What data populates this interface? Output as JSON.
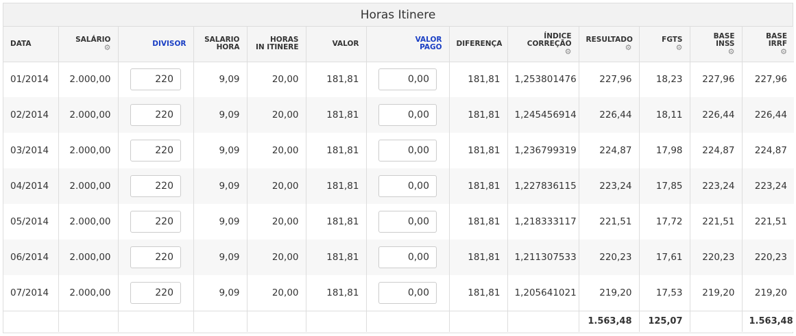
{
  "title": "Horas Itinere",
  "columns": [
    {
      "label1": "DATA",
      "label2": "",
      "gear": false
    },
    {
      "label1": "SALÁRIO",
      "label2": "",
      "gear": true
    },
    {
      "label1": "DIVISOR",
      "label2": "",
      "gear": false
    },
    {
      "label1": "SALARIO",
      "label2": "HORA",
      "gear": false
    },
    {
      "label1": "HORAS",
      "label2": "IN ITINERE",
      "gear": false
    },
    {
      "label1": "VALOR",
      "label2": "",
      "gear": false
    },
    {
      "label1": "VALOR",
      "label2": "PAGO",
      "gear": false
    },
    {
      "label1": "DIFERENÇA",
      "label2": "",
      "gear": false
    },
    {
      "label1": "ÍNDICE",
      "label2": "CORREÇÃO",
      "gear": true
    },
    {
      "label1": "RESULTADO",
      "label2": "",
      "gear": true
    },
    {
      "label1": "FGTS",
      "label2": "",
      "gear": true
    },
    {
      "label1": "BASE",
      "label2": "INSS",
      "gear": true
    },
    {
      "label1": "BASE",
      "label2": "IRRF",
      "gear": true
    }
  ],
  "gear_icon": "⚙",
  "rows": [
    {
      "data": "01/2014",
      "salario": "2.000,00",
      "divisor": "220",
      "salario_hora": "9,09",
      "horas": "20,00",
      "valor": "181,81",
      "valor_pago": "0,00",
      "diferenca": "181,81",
      "indice": "1,253801476",
      "resultado": "227,96",
      "fgts": "18,23",
      "base_inss": "227,96",
      "base_irrf": "227,96"
    },
    {
      "data": "02/2014",
      "salario": "2.000,00",
      "divisor": "220",
      "salario_hora": "9,09",
      "horas": "20,00",
      "valor": "181,81",
      "valor_pago": "0,00",
      "diferenca": "181,81",
      "indice": "1,245456914",
      "resultado": "226,44",
      "fgts": "18,11",
      "base_inss": "226,44",
      "base_irrf": "226,44"
    },
    {
      "data": "03/2014",
      "salario": "2.000,00",
      "divisor": "220",
      "salario_hora": "9,09",
      "horas": "20,00",
      "valor": "181,81",
      "valor_pago": "0,00",
      "diferenca": "181,81",
      "indice": "1,236799319",
      "resultado": "224,87",
      "fgts": "17,98",
      "base_inss": "224,87",
      "base_irrf": "224,87"
    },
    {
      "data": "04/2014",
      "salario": "2.000,00",
      "divisor": "220",
      "salario_hora": "9,09",
      "horas": "20,00",
      "valor": "181,81",
      "valor_pago": "0,00",
      "diferenca": "181,81",
      "indice": "1,227836115",
      "resultado": "223,24",
      "fgts": "17,85",
      "base_inss": "223,24",
      "base_irrf": "223,24"
    },
    {
      "data": "05/2014",
      "salario": "2.000,00",
      "divisor": "220",
      "salario_hora": "9,09",
      "horas": "20,00",
      "valor": "181,81",
      "valor_pago": "0,00",
      "diferenca": "181,81",
      "indice": "1,218333117",
      "resultado": "221,51",
      "fgts": "17,72",
      "base_inss": "221,51",
      "base_irrf": "221,51"
    },
    {
      "data": "06/2014",
      "salario": "2.000,00",
      "divisor": "220",
      "salario_hora": "9,09",
      "horas": "20,00",
      "valor": "181,81",
      "valor_pago": "0,00",
      "diferenca": "181,81",
      "indice": "1,211307533",
      "resultado": "220,23",
      "fgts": "17,61",
      "base_inss": "220,23",
      "base_irrf": "220,23"
    },
    {
      "data": "07/2014",
      "salario": "2.000,00",
      "divisor": "220",
      "salario_hora": "9,09",
      "horas": "20,00",
      "valor": "181,81",
      "valor_pago": "0,00",
      "diferenca": "181,81",
      "indice": "1,205641021",
      "resultado": "219,20",
      "fgts": "17,53",
      "base_inss": "219,20",
      "base_irrf": "219,20"
    }
  ],
  "totals": {
    "resultado": "1.563,48",
    "fgts": "125,07",
    "base_irrf": "1.563,48"
  },
  "colors": {
    "link_blue": "#1a3fc4",
    "header_bg": "#f5f5f5",
    "border": "#dddddd"
  }
}
